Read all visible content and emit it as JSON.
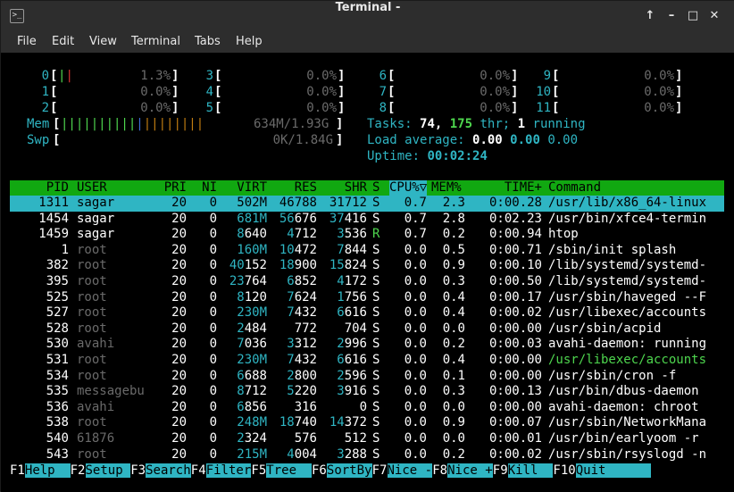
{
  "window": {
    "title": "Terminal -"
  },
  "menu": [
    "File",
    "Edit",
    "View",
    "Terminal",
    "Tabs",
    "Help"
  ],
  "meters": {
    "cpus": [
      {
        "id": "0",
        "pct": "1.3%"
      },
      {
        "id": "1",
        "pct": "0.0%"
      },
      {
        "id": "2",
        "pct": "0.0%"
      },
      {
        "id": "3",
        "pct": "0.0%"
      },
      {
        "id": "4",
        "pct": "0.0%"
      },
      {
        "id": "5",
        "pct": "0.0%"
      },
      {
        "id": "6",
        "pct": "0.0%"
      },
      {
        "id": "7",
        "pct": "0.0%"
      },
      {
        "id": "8",
        "pct": "0.0%"
      },
      {
        "id": "9",
        "pct": "0.0%"
      },
      {
        "id": "10",
        "pct": "0.0%"
      },
      {
        "id": "11",
        "pct": "0.0%"
      }
    ],
    "mem_label": "Mem",
    "mem_value": "634M/1.93G",
    "swp_label": "Swp",
    "swp_value": "0K/1.84G"
  },
  "summary": {
    "tasks_label": "Tasks:",
    "tasks": "74,",
    "thr": "175",
    "thr_label": "thr;",
    "running": "1",
    "running_label": "running",
    "load_label": "Load average:",
    "load1": "0.00",
    "load5": "0.00",
    "load15": "0.00",
    "uptime_label": "Uptime:",
    "uptime": "00:02:24"
  },
  "columns": [
    "PID",
    "USER",
    "PRI",
    "NI",
    "VIRT",
    "RES",
    "SHR",
    "S",
    "CPU%▽",
    "MEM%",
    "TIME+",
    "Command"
  ],
  "processes": [
    {
      "pid": "1311",
      "user": "sagar",
      "pri": "20",
      "ni": "0",
      "virt": "502M",
      "res": "46788",
      "shr": "31712",
      "s": "S",
      "cpu": "0.7",
      "mem": "2.3",
      "time": "0:00.28",
      "cmd": "/usr/lib/x86_64-linux"
    },
    {
      "pid": "1454",
      "user": "sagar",
      "pri": "20",
      "ni": "0",
      "virt": "681M",
      "res": "56676",
      "shr": "37416",
      "s": "S",
      "cpu": "0.7",
      "mem": "2.8",
      "time": "0:02.23",
      "cmd": "/usr/bin/xfce4-termin"
    },
    {
      "pid": "1459",
      "user": "sagar",
      "pri": "20",
      "ni": "0",
      "virt": "8640",
      "res": "4712",
      "shr": "3536",
      "s": "R",
      "cpu": "0.7",
      "mem": "0.2",
      "time": "0:00.94",
      "cmd": "htop"
    },
    {
      "pid": "1",
      "user": "root",
      "pri": "20",
      "ni": "0",
      "virt": "160M",
      "res": "10472",
      "shr": "7844",
      "s": "S",
      "cpu": "0.0",
      "mem": "0.5",
      "time": "0:00.71",
      "cmd": "/sbin/init splash"
    },
    {
      "pid": "382",
      "user": "root",
      "pri": "20",
      "ni": "0",
      "virt": "40152",
      "res": "18900",
      "shr": "15824",
      "s": "S",
      "cpu": "0.0",
      "mem": "0.9",
      "time": "0:00.10",
      "cmd": "/lib/systemd/systemd-"
    },
    {
      "pid": "395",
      "user": "root",
      "pri": "20",
      "ni": "0",
      "virt": "23764",
      "res": "6852",
      "shr": "4172",
      "s": "S",
      "cpu": "0.0",
      "mem": "0.3",
      "time": "0:00.50",
      "cmd": "/lib/systemd/systemd-"
    },
    {
      "pid": "525",
      "user": "root",
      "pri": "20",
      "ni": "0",
      "virt": "8120",
      "res": "7624",
      "shr": "1756",
      "s": "S",
      "cpu": "0.0",
      "mem": "0.4",
      "time": "0:00.17",
      "cmd": "/usr/sbin/haveged --F"
    },
    {
      "pid": "527",
      "user": "root",
      "pri": "20",
      "ni": "0",
      "virt": "230M",
      "res": "7432",
      "shr": "6616",
      "s": "S",
      "cpu": "0.0",
      "mem": "0.4",
      "time": "0:00.02",
      "cmd": "/usr/libexec/accounts"
    },
    {
      "pid": "528",
      "user": "root",
      "pri": "20",
      "ni": "0",
      "virt": "2484",
      "res": "772",
      "shr": "704",
      "s": "S",
      "cpu": "0.0",
      "mem": "0.0",
      "time": "0:00.00",
      "cmd": "/usr/sbin/acpid"
    },
    {
      "pid": "530",
      "user": "avahi",
      "pri": "20",
      "ni": "0",
      "virt": "7036",
      "res": "3312",
      "shr": "2996",
      "s": "S",
      "cpu": "0.0",
      "mem": "0.2",
      "time": "0:00.03",
      "cmd": "avahi-daemon: running"
    },
    {
      "pid": "531",
      "user": "root",
      "pri": "20",
      "ni": "0",
      "virt": "230M",
      "res": "7432",
      "shr": "6616",
      "s": "S",
      "cpu": "0.0",
      "mem": "0.4",
      "time": "0:00.00",
      "cmd": "/usr/libexec/accounts"
    },
    {
      "pid": "534",
      "user": "root",
      "pri": "20",
      "ni": "0",
      "virt": "6688",
      "res": "2800",
      "shr": "2596",
      "s": "S",
      "cpu": "0.0",
      "mem": "0.1",
      "time": "0:00.00",
      "cmd": "/usr/sbin/cron -f"
    },
    {
      "pid": "535",
      "user": "messagebu",
      "pri": "20",
      "ni": "0",
      "virt": "8712",
      "res": "5220",
      "shr": "3916",
      "s": "S",
      "cpu": "0.0",
      "mem": "0.3",
      "time": "0:00.13",
      "cmd": "/usr/bin/dbus-daemon"
    },
    {
      "pid": "536",
      "user": "avahi",
      "pri": "20",
      "ni": "0",
      "virt": "6856",
      "res": "316",
      "shr": "0",
      "s": "S",
      "cpu": "0.0",
      "mem": "0.0",
      "time": "0:00.00",
      "cmd": "avahi-daemon: chroot"
    },
    {
      "pid": "538",
      "user": "root",
      "pri": "20",
      "ni": "0",
      "virt": "248M",
      "res": "18740",
      "shr": "14372",
      "s": "S",
      "cpu": "0.0",
      "mem": "0.9",
      "time": "0:00.07",
      "cmd": "/usr/sbin/NetworkMana"
    },
    {
      "pid": "540",
      "user": "61876",
      "pri": "20",
      "ni": "0",
      "virt": "2324",
      "res": "576",
      "shr": "512",
      "s": "S",
      "cpu": "0.0",
      "mem": "0.0",
      "time": "0:00.01",
      "cmd": "/usr/bin/earlyoom -r"
    },
    {
      "pid": "543",
      "user": "root",
      "pri": "20",
      "ni": "0",
      "virt": "215M",
      "res": "4004",
      "shr": "3288",
      "s": "S",
      "cpu": "0.0",
      "mem": "0.2",
      "time": "0:00.02",
      "cmd": "/usr/sbin/rsyslogd -n"
    }
  ],
  "footer": [
    {
      "key": "F1",
      "label": "Help"
    },
    {
      "key": "F2",
      "label": "Setup"
    },
    {
      "key": "F3",
      "label": "Search"
    },
    {
      "key": "F4",
      "label": "Filter"
    },
    {
      "key": "F5",
      "label": "Tree"
    },
    {
      "key": "F6",
      "label": "SortBy"
    },
    {
      "key": "F7",
      "label": "Nice -"
    },
    {
      "key": "F8",
      "label": "Nice +"
    },
    {
      "key": "F9",
      "label": "Kill"
    },
    {
      "key": "F10",
      "label": "Quit"
    }
  ]
}
